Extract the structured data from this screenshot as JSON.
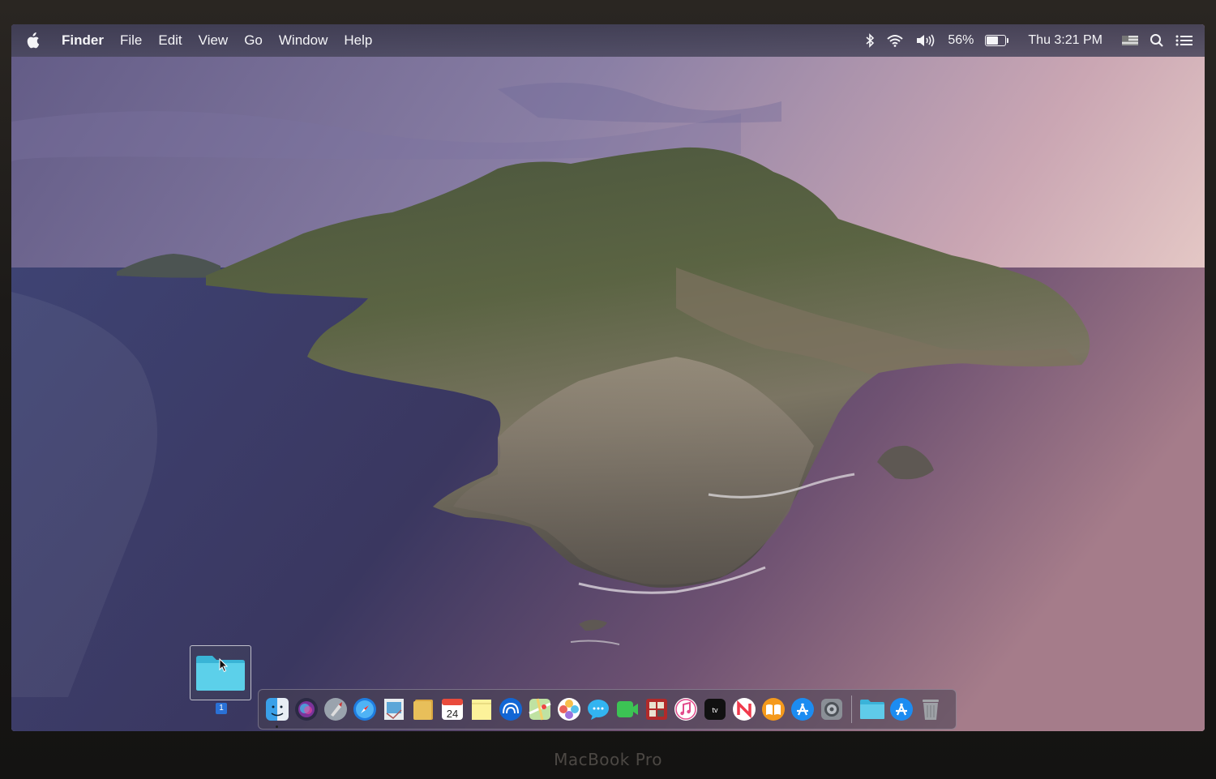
{
  "menubar": {
    "app_name": "Finder",
    "menus": [
      "File",
      "Edit",
      "View",
      "Go",
      "Window",
      "Help"
    ],
    "battery_percent": "56%",
    "battery_level": 0.56,
    "clock": "Thu 3:21 PM",
    "icons": [
      "apple-icon",
      "bluetooth-icon",
      "wifi-icon",
      "volume-icon",
      "battery-icon",
      "input-flag-icon",
      "spotlight-icon",
      "notification-center-icon"
    ]
  },
  "desktop": {
    "space_number": "1"
  },
  "dock": {
    "apps": [
      "finder",
      "siri",
      "launchpad",
      "safari",
      "mail",
      "notes-yellow",
      "calendar",
      "stickies",
      "airdrop",
      "maps",
      "photos",
      "messages",
      "facetime",
      "photo-booth",
      "itunes",
      "apple-tv",
      "news",
      "books",
      "app-store",
      "system-preferences"
    ],
    "calendar_day": "24",
    "tv_label": "tv",
    "folders": [
      "downloads-folder",
      "app-store-folder",
      "trash"
    ]
  },
  "hardware": {
    "brand": "MacBook Pro"
  }
}
